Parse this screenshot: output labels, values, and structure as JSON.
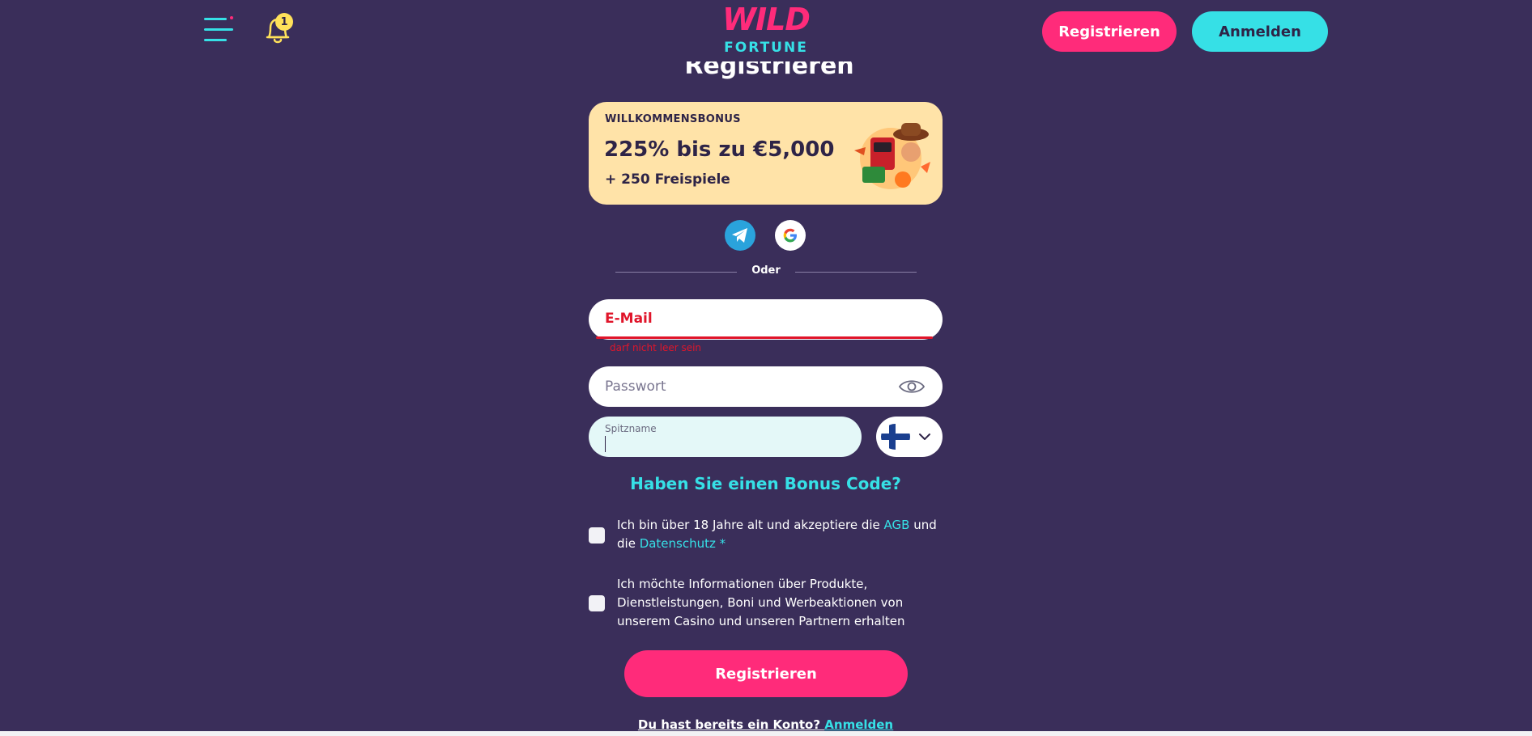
{
  "header": {
    "menu_icon": "menu-icon",
    "bell_icon": "bell-icon",
    "notification_count": "1",
    "logo": {
      "line1": "WILD",
      "line2": "FORTUNE"
    },
    "register_label": "Registrieren",
    "login_label": "Anmelden"
  },
  "page": {
    "title": "Registrieren"
  },
  "bonus": {
    "label": "WILLKOMMENSBONUS",
    "amount": "225% bis zu €5,000",
    "spins": "+ 250 Freispiele"
  },
  "social": {
    "telegram_icon": "telegram-icon",
    "google_icon": "google-icon"
  },
  "divider": {
    "label": "Oder"
  },
  "form": {
    "email_label": "E-Mail",
    "email_error": "darf nicht leer sein",
    "password_placeholder": "Passwort",
    "nickname_label": "Spitzname",
    "nickname_value": "",
    "country_flag": "finland-flag-icon",
    "bonus_code_link": "Haben Sie einen Bonus Code?",
    "terms": {
      "text_before": "Ich bin über 18 Jahre alt und akzeptiere die ",
      "agb_link": "AGB",
      "text_middle": " und die ",
      "privacy_link": "Datenschutz *"
    },
    "marketing_text": "Ich möchte Informationen über Produkte, Dienstleistungen, Boni und Werbeaktionen von unserem Casino und unseren Partnern erhalten",
    "submit_label": "Registrieren",
    "have_account_text": "Du hast bereits ein Konto? ",
    "have_account_link": "Anmelden"
  },
  "colors": {
    "background": "#3a2e5a",
    "accent_pink": "#ff2b7a",
    "accent_cyan": "#36e0e6",
    "bonus_card": "#ffe3a8",
    "error_red": "#e0152a"
  }
}
